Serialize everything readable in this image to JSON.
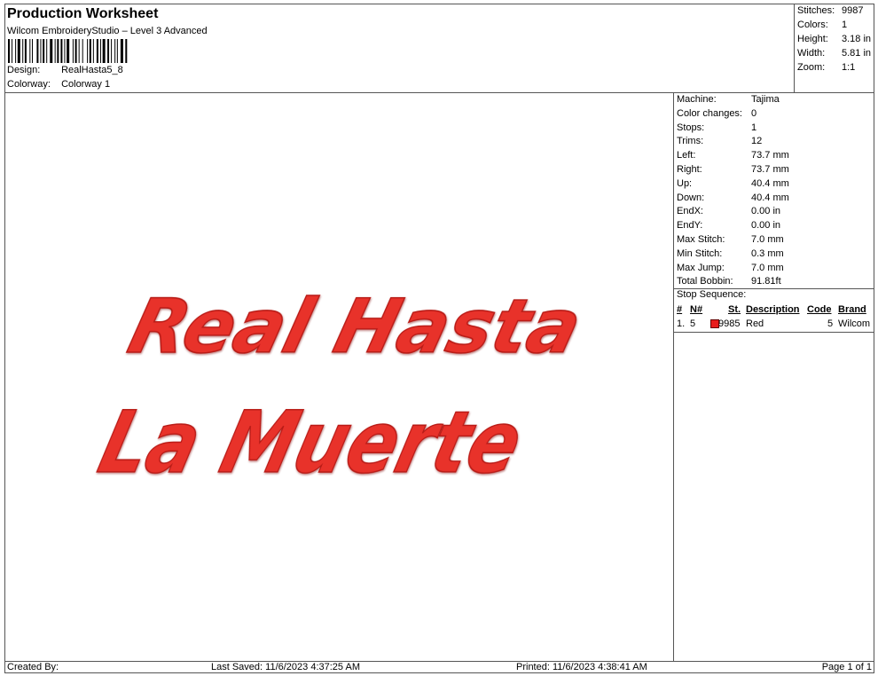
{
  "header": {
    "title": "Production Worksheet",
    "subtitle": "Wilcom EmbroideryStudio – Level 3 Advanced",
    "design_label": "Design:",
    "design_value": "RealHasta5_8",
    "colorway_label": "Colorway:",
    "colorway_value": "Colorway 1"
  },
  "stats": {
    "stitches_label": "Stitches:",
    "stitches_value": "9987",
    "colors_label": "Colors:",
    "colors_value": "1",
    "height_label": "Height:",
    "height_value": "3.18 in",
    "width_label": "Width:",
    "width_value": "5.81 in",
    "zoom_label": "Zoom:",
    "zoom_value": "1:1"
  },
  "design": {
    "line1": "Real Hasta",
    "line2": "La Muerte",
    "thread_color": "#e8302b"
  },
  "info": [
    {
      "label": "Machine:",
      "value": "Tajima"
    },
    {
      "label": "Color changes:",
      "value": "0"
    },
    {
      "label": "Stops:",
      "value": "1"
    },
    {
      "label": "Trims:",
      "value": "12"
    },
    {
      "label": "Left:",
      "value": "73.7 mm"
    },
    {
      "label": "Right:",
      "value": "73.7 mm"
    },
    {
      "label": "Up:",
      "value": "40.4 mm"
    },
    {
      "label": "Down:",
      "value": "40.4 mm"
    },
    {
      "label": "EndX:",
      "value": "0.00 in"
    },
    {
      "label": "EndY:",
      "value": "0.00 in"
    },
    {
      "label": "Max Stitch:",
      "value": "7.0 mm"
    },
    {
      "label": "Min Stitch:",
      "value": "0.3 mm"
    },
    {
      "label": "Max Jump:",
      "value": "7.0 mm"
    },
    {
      "label": "Total Bobbin:",
      "value": "91.81ft"
    }
  ],
  "stop_sequence": {
    "title": "Stop Sequence:",
    "headers": {
      "num": "#",
      "n": "N#",
      "st": "St.",
      "description": "Description",
      "code": "Code",
      "brand": "Brand"
    },
    "rows": [
      {
        "num": "1.",
        "n": "5",
        "st": "9985",
        "description": "Red",
        "code": "5",
        "brand": "Wilcom",
        "color": "#e81c1c"
      }
    ]
  },
  "footer": {
    "created_by": "Created By:",
    "last_saved": "Last Saved: 11/6/2023 4:37:25 AM",
    "printed": "Printed: 11/6/2023 4:38:41 AM",
    "page": "Page 1 of 1"
  }
}
